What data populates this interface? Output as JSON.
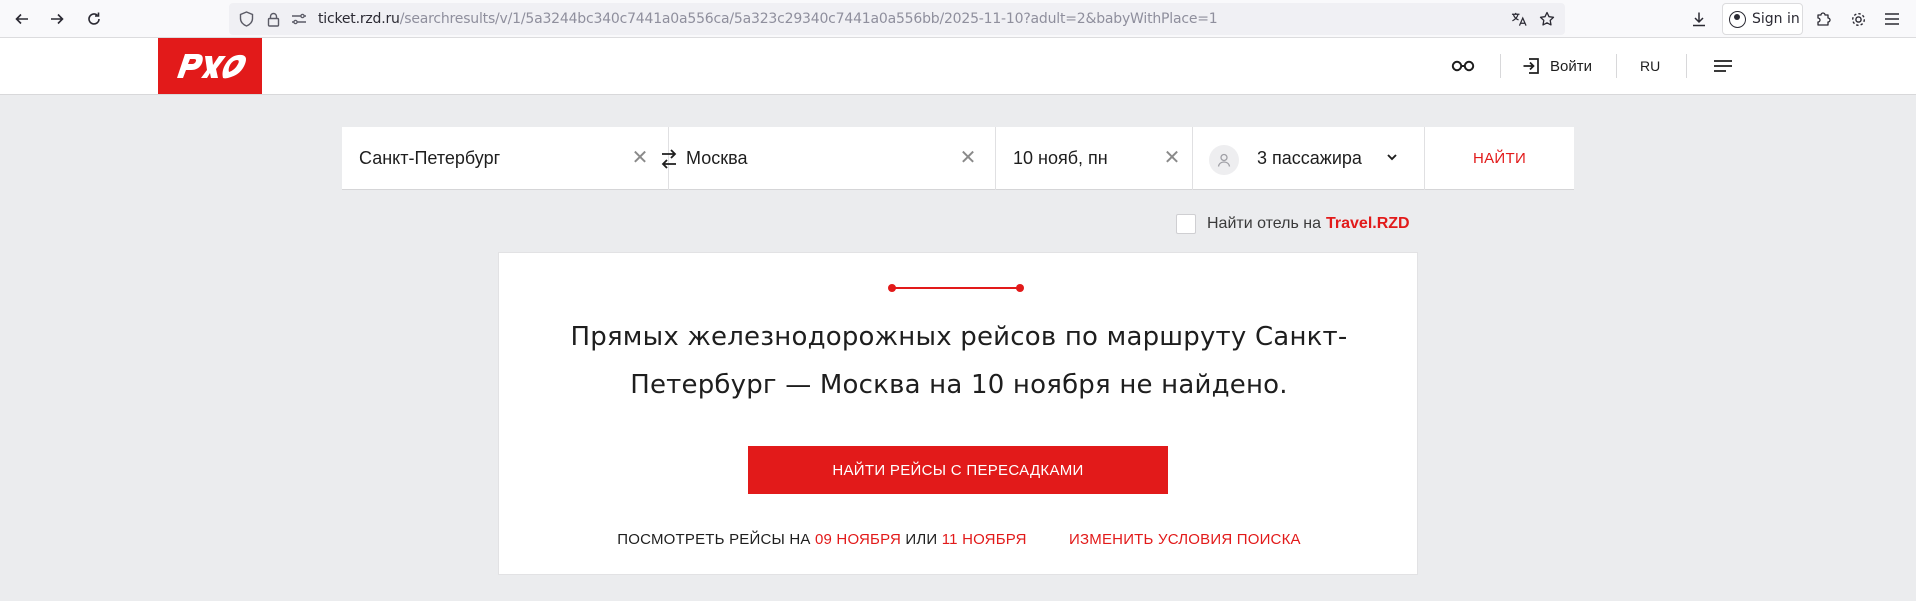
{
  "browser": {
    "url_host": "ticket.rzd.ru",
    "url_path": "/searchresults/v/1/5a3244bc340c7441a0a556ca/5a323c29340c7441a0a556bb/2025-11-10?adult=2&babyWithPlace=1",
    "signin_label": "Sign in"
  },
  "header": {
    "login_label": "Войти",
    "lang_label": "RU",
    "brand_color": "#e21a1a"
  },
  "search": {
    "from": "Санкт-Петербург",
    "to": "Москва",
    "date": "10 нояб, пн",
    "passengers": "3 пассажира",
    "find_label": "НАЙТИ"
  },
  "hotel": {
    "label": "Найти отель на",
    "brand": "Travel.RZD",
    "checked": false
  },
  "result": {
    "message": "Прямых железнодорожных рейсов по маршруту Санкт-Петербург — Москва на 10 ноября не найдено.",
    "transfer_button": "НАЙТИ РЕЙСЫ С ПЕРЕСАДКАМИ",
    "view_prefix": "ПОСМОТРЕТЬ РЕЙСЫ НА",
    "date_prev": "09 НОЯБРЯ",
    "or_label": "ИЛИ",
    "date_next": "11 НОЯБРЯ",
    "change_search": "ИЗМЕНИТЬ УСЛОВИЯ ПОИСКА"
  }
}
